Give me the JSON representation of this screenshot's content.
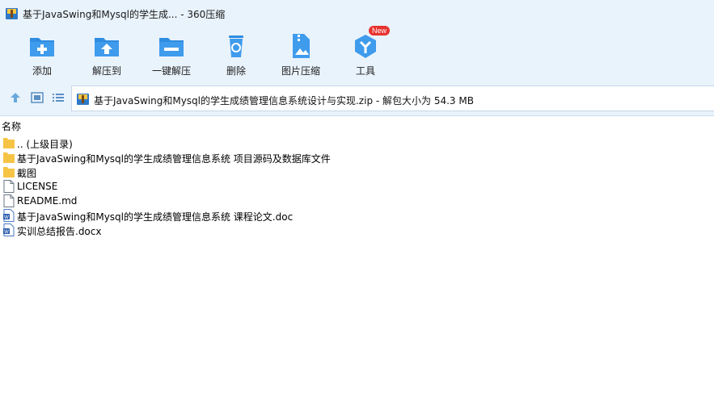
{
  "window": {
    "title": "基于JavaSwing和Mysql的学生成... - 360压缩"
  },
  "toolbar": {
    "items": [
      {
        "label": "添加",
        "icon": "add-folder-icon"
      },
      {
        "label": "解压到",
        "icon": "extract-to-icon"
      },
      {
        "label": "一键解压",
        "icon": "one-click-extract-icon"
      },
      {
        "label": "删除",
        "icon": "delete-icon"
      },
      {
        "label": "图片压缩",
        "icon": "image-compress-icon"
      },
      {
        "label": "工具",
        "icon": "tools-icon",
        "badge": "New"
      }
    ]
  },
  "addressbar": {
    "path": "基于JavaSwing和Mysql的学生成绩管理信息系统设计与实现.zip - 解包大小为 54.3 MB"
  },
  "filelist": {
    "column_name": "名称",
    "rows": [
      {
        "name": ".. (上级目录)",
        "type": "folder"
      },
      {
        "name": "基于JavaSwing和Mysql的学生成绩管理信息系统 项目源码及数据库文件",
        "type": "folder"
      },
      {
        "name": "截图",
        "type": "folder"
      },
      {
        "name": "LICENSE",
        "type": "file"
      },
      {
        "name": "README.md",
        "type": "file"
      },
      {
        "name": "基于JavaSwing和Mysql的学生成绩管理信息系统 课程论文.doc",
        "type": "word"
      },
      {
        "name": "实训总结报告.docx",
        "type": "word"
      }
    ]
  },
  "colors": {
    "accent": "#2f8ce0",
    "chrome_bg": "#e9f3fc",
    "folder": "#f6c445",
    "badge": "#e8332f"
  }
}
